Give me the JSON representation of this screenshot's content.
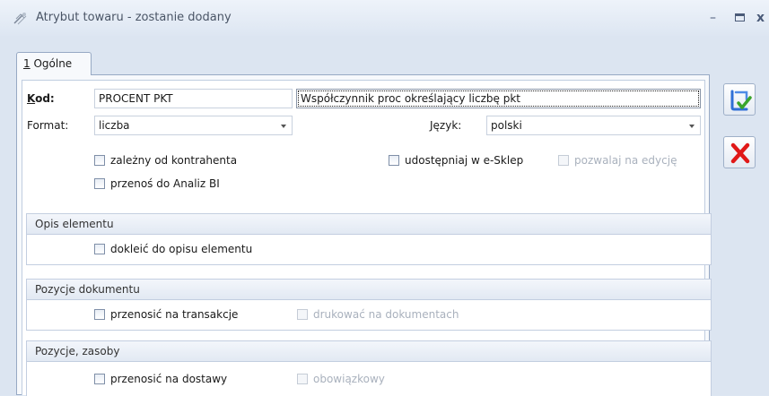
{
  "window": {
    "title": "Atrybut towaru - zostanie dodany",
    "minimize": "–",
    "close": "x"
  },
  "tab": {
    "key": "1",
    "label": " Ogólne"
  },
  "form": {
    "kod_label_key": "K",
    "kod_label_rest": "od:",
    "kod_value": "PROCENT PKT",
    "description_value": "Współczynnik proc określający liczbę pkt",
    "format_label": "Format:",
    "format_value": "liczba",
    "jezyk_label": "Język:",
    "jezyk_value": "polski",
    "checkboxes": {
      "zalezny": {
        "label": "zależny od kontrahenta",
        "checked": false,
        "enabled": true
      },
      "analiz": {
        "label": "przenoś do Analiz BI",
        "checked": false,
        "enabled": true
      },
      "eshop": {
        "label": "udostępniaj w e-Sklep",
        "checked": false,
        "enabled": true
      },
      "edycja": {
        "label": "pozwalaj na edycję",
        "checked": false,
        "enabled": false
      }
    }
  },
  "groups": {
    "opis": {
      "title": "Opis elementu",
      "dokleic": {
        "label": "dokleić do opisu elementu",
        "checked": false,
        "enabled": true
      }
    },
    "pozycje_dok": {
      "title": "Pozycje dokumentu",
      "transakcje": {
        "label": "przenosić na transakcje",
        "checked": false,
        "enabled": true
      },
      "drukowac": {
        "label": "drukować na dokumentach",
        "checked": false,
        "enabled": false
      }
    },
    "pozycje_zasoby": {
      "title": "Pozycje, zasoby",
      "dostawy": {
        "label": "przenosić na dostawy",
        "checked": false,
        "enabled": true
      },
      "obowiazkowy": {
        "label": "obowiązkowy",
        "checked": false,
        "enabled": false
      }
    }
  },
  "buttons": {
    "save_icon": "save-check-icon",
    "cancel_icon": "red-x-icon"
  },
  "colors": {
    "accent": "#2f6fd6",
    "check_green": "#3aa52b",
    "cancel_red": "#e01818",
    "window_bg": "#dce5f1"
  }
}
